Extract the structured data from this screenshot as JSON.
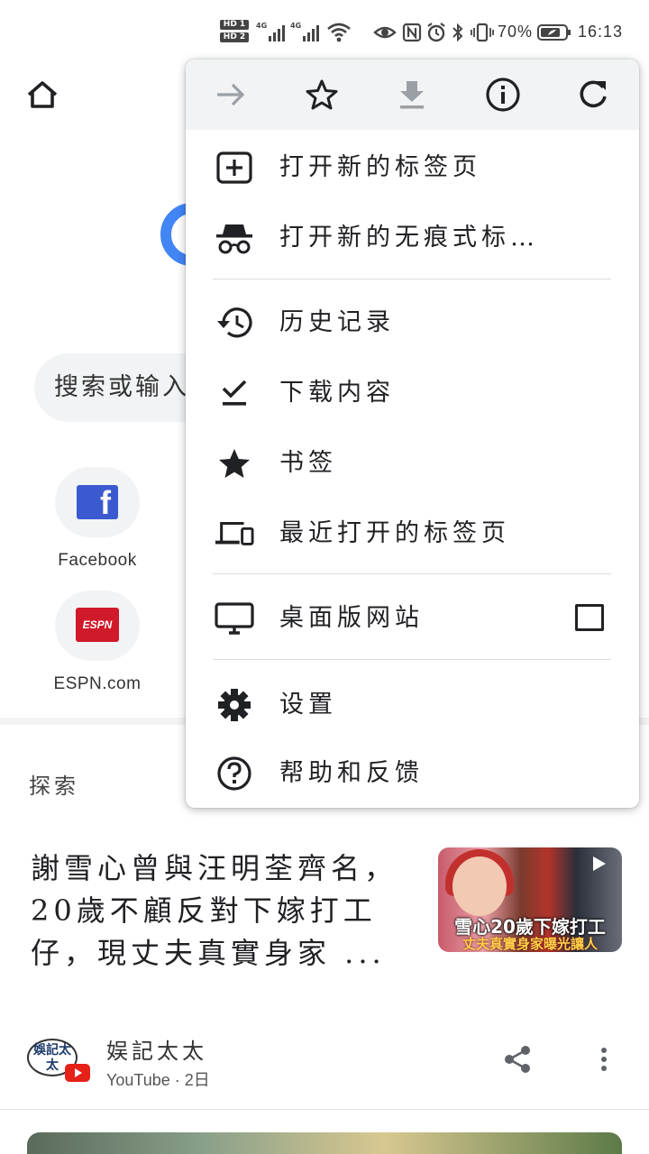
{
  "status_bar": {
    "hd1": "HD 1",
    "hd2": "HD 2",
    "net1": "4G",
    "net2": "4G",
    "wifi_badge": "6",
    "battery": "70%",
    "time": "16:13"
  },
  "page": {
    "search_placeholder": "搜索或输入",
    "shortcuts": [
      {
        "label": "Facebook",
        "glyph": "f"
      },
      {
        "label": "ESPN.com",
        "glyph": "ESPN"
      }
    ],
    "explore_heading": "探索",
    "article": {
      "title": "謝雪心曾與汪明荃齊名，20歲不顧反對下嫁打工仔，現丈夫真實身家 ...",
      "thumb_caption_1": "雪心20歲下嫁打工",
      "thumb_caption_2": "丈夫真實身家曝光讓人",
      "source_logo_text": "娛記太太",
      "source_name": "娱記太太",
      "source_meta": "YouTube · 2日"
    }
  },
  "menu": {
    "toolbar": [
      {
        "name": "forward",
        "icon": "arrow-right-icon",
        "enabled": false
      },
      {
        "name": "bookmark",
        "icon": "star-outline-icon",
        "enabled": true
      },
      {
        "name": "download",
        "icon": "download-icon",
        "enabled": false
      },
      {
        "name": "info",
        "icon": "info-icon",
        "enabled": true
      },
      {
        "name": "refresh",
        "icon": "refresh-icon",
        "enabled": true
      }
    ],
    "items": [
      {
        "label": "打开新的标签页",
        "icon": "plus-box-icon"
      },
      {
        "label": "打开新的无痕式标…",
        "icon": "incognito-icon"
      },
      {
        "label": "历史记录",
        "icon": "history-icon"
      },
      {
        "label": "下载内容",
        "icon": "download-check-icon"
      },
      {
        "label": "书签",
        "icon": "star-icon"
      },
      {
        "label": "最近打开的标签页",
        "icon": "devices-icon"
      },
      {
        "label": "桌面版网站",
        "icon": "monitor-icon",
        "checkbox": false
      },
      {
        "label": "设置",
        "icon": "gear-icon"
      },
      {
        "label": "帮助和反馈",
        "icon": "help-icon"
      }
    ]
  },
  "colors": {
    "menu_header_bg": "#f1f3f4",
    "icon": "#202124",
    "disabled_icon": "#9aa0a6",
    "google_blue": "#4285f4",
    "facebook": "#3b5ad0",
    "espn": "#d0192a",
    "youtube": "#e62117"
  }
}
